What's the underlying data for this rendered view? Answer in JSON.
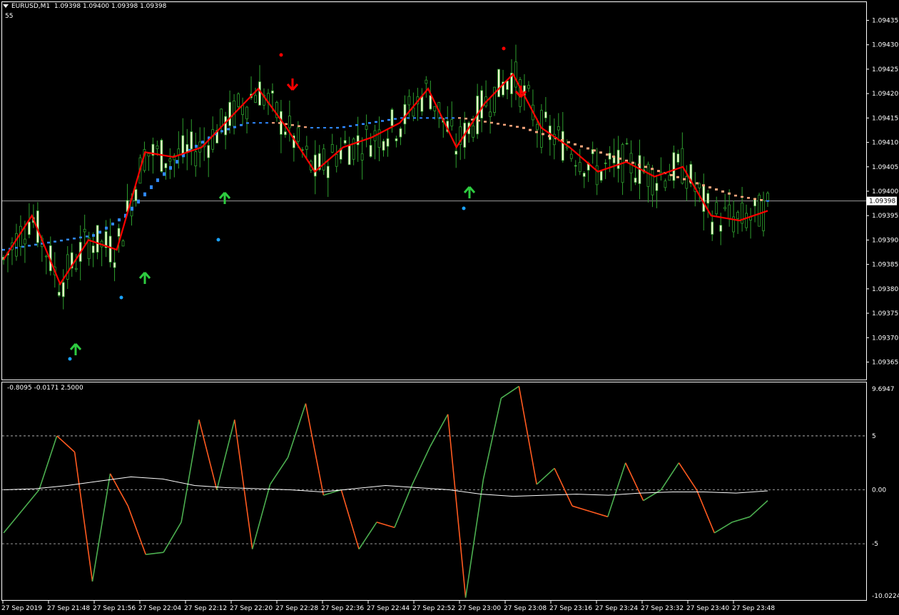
{
  "header": {
    "symbol": "EURUSD,M1",
    "ohlc": "1.09398 1.09400 1.09398 1.09398",
    "sub": "55",
    "dropdown_icon": "triangle-down-icon"
  },
  "price_axis": {
    "labels": [
      "1.09435",
      "1.09430",
      "1.09425",
      "1.09420",
      "1.09415",
      "1.09410",
      "1.09405",
      "1.09400",
      "1.09395",
      "1.09390",
      "1.09385",
      "1.09380",
      "1.09375",
      "1.09370",
      "1.09365"
    ],
    "current": "1.09398"
  },
  "oscillator": {
    "header": "-0.8095 -0.0171 2.5000",
    "axis_labels": [
      "9.6947",
      "5",
      "0.00",
      "-5",
      "-10.0224"
    ]
  },
  "time_axis": [
    "27 Sep 2019",
    "27 Sep 21:48",
    "27 Sep 21:56",
    "27 Sep 22:04",
    "27 Sep 22:12",
    "27 Sep 22:20",
    "27 Sep 22:28",
    "27 Sep 22:36",
    "27 Sep 22:44",
    "27 Sep 22:52",
    "27 Sep 23:00",
    "27 Sep 23:08",
    "27 Sep 23:16",
    "27 Sep 23:24",
    "27 Sep 23:32",
    "27 Sep 23:40",
    "27 Sep 23:48"
  ],
  "colors": {
    "background": "#000000",
    "bull_candle": "#f0ffd0",
    "candle_wick": "#2e9e2e",
    "red_line": "#ff0000",
    "blue_ma": "#2f88ff",
    "orange_ma": "#f5a37a",
    "osc_up": "#4caf50",
    "osc_down": "#ff5a1f",
    "arrow_up": "#2ecc40",
    "arrow_down": "#ff0000",
    "dot_blue": "#1aa3ff",
    "dot_red": "#ff0000"
  },
  "chart_data": {
    "type": "line",
    "x": [
      "27 Sep 2019",
      "27 Sep 21:48",
      "27 Sep 21:56",
      "27 Sep 22:04",
      "27 Sep 22:12",
      "27 Sep 22:20",
      "27 Sep 22:28",
      "27 Sep 22:36",
      "27 Sep 22:44",
      "27 Sep 22:52",
      "27 Sep 23:00",
      "27 Sep 23:08",
      "27 Sep 23:16",
      "27 Sep 23:24",
      "27 Sep 23:32",
      "27 Sep 23:40",
      "27 Sep 23:48"
    ],
    "price_ylim": [
      1.09362,
      1.09438
    ],
    "red_line_values": [
      1.09386,
      1.09395,
      1.09381,
      1.0939,
      1.09388,
      1.09408,
      1.09407,
      1.09409,
      1.09415,
      1.09421,
      1.09413,
      1.09404,
      1.09409,
      1.09411,
      1.09414,
      1.09421,
      1.09409,
      1.09418,
      1.09424,
      1.09413,
      1.09409,
      1.09404,
      1.09406,
      1.09403,
      1.09405,
      1.09395,
      1.09394,
      1.09396
    ],
    "ma_values": [
      1.09388,
      1.09389,
      1.0939,
      1.09391,
      1.09395,
      1.09402,
      1.09408,
      1.09412,
      1.09414,
      1.09414,
      1.09413,
      1.09413,
      1.09414,
      1.09415,
      1.09415,
      1.09415,
      1.09414,
      1.09413,
      1.09411,
      1.09409,
      1.09407,
      1.09405,
      1.09403,
      1.09401,
      1.09399,
      1.09398
    ],
    "osc_ylim": [
      -10.0224,
      9.6947
    ],
    "osc_values": [
      -4,
      -2,
      0,
      5,
      3.5,
      -8.5,
      1.5,
      -1.5,
      -6,
      -5.8,
      -3,
      6.5,
      0,
      6.5,
      -5.5,
      0.5,
      3,
      8,
      -0.5,
      0,
      -5.5,
      -3,
      -3.5,
      0.5,
      4,
      7,
      -10,
      1,
      8.5,
      9.6,
      0.5,
      2,
      -1.5,
      -2,
      -2.5,
      2.5,
      -1,
      0,
      2.5,
      0,
      -4,
      -3,
      -2.5,
      -1
    ],
    "signal_values": [
      0,
      0.1,
      0.4,
      0.8,
      1.2,
      1.0,
      0.4,
      0.2,
      0.1,
      0.0,
      -0.2,
      0.1,
      0.4,
      0.2,
      0.0,
      -0.4,
      -0.6,
      -0.5,
      -0.4,
      -0.5,
      -0.3,
      -0.2,
      -0.2,
      -0.3,
      -0.1
    ]
  }
}
